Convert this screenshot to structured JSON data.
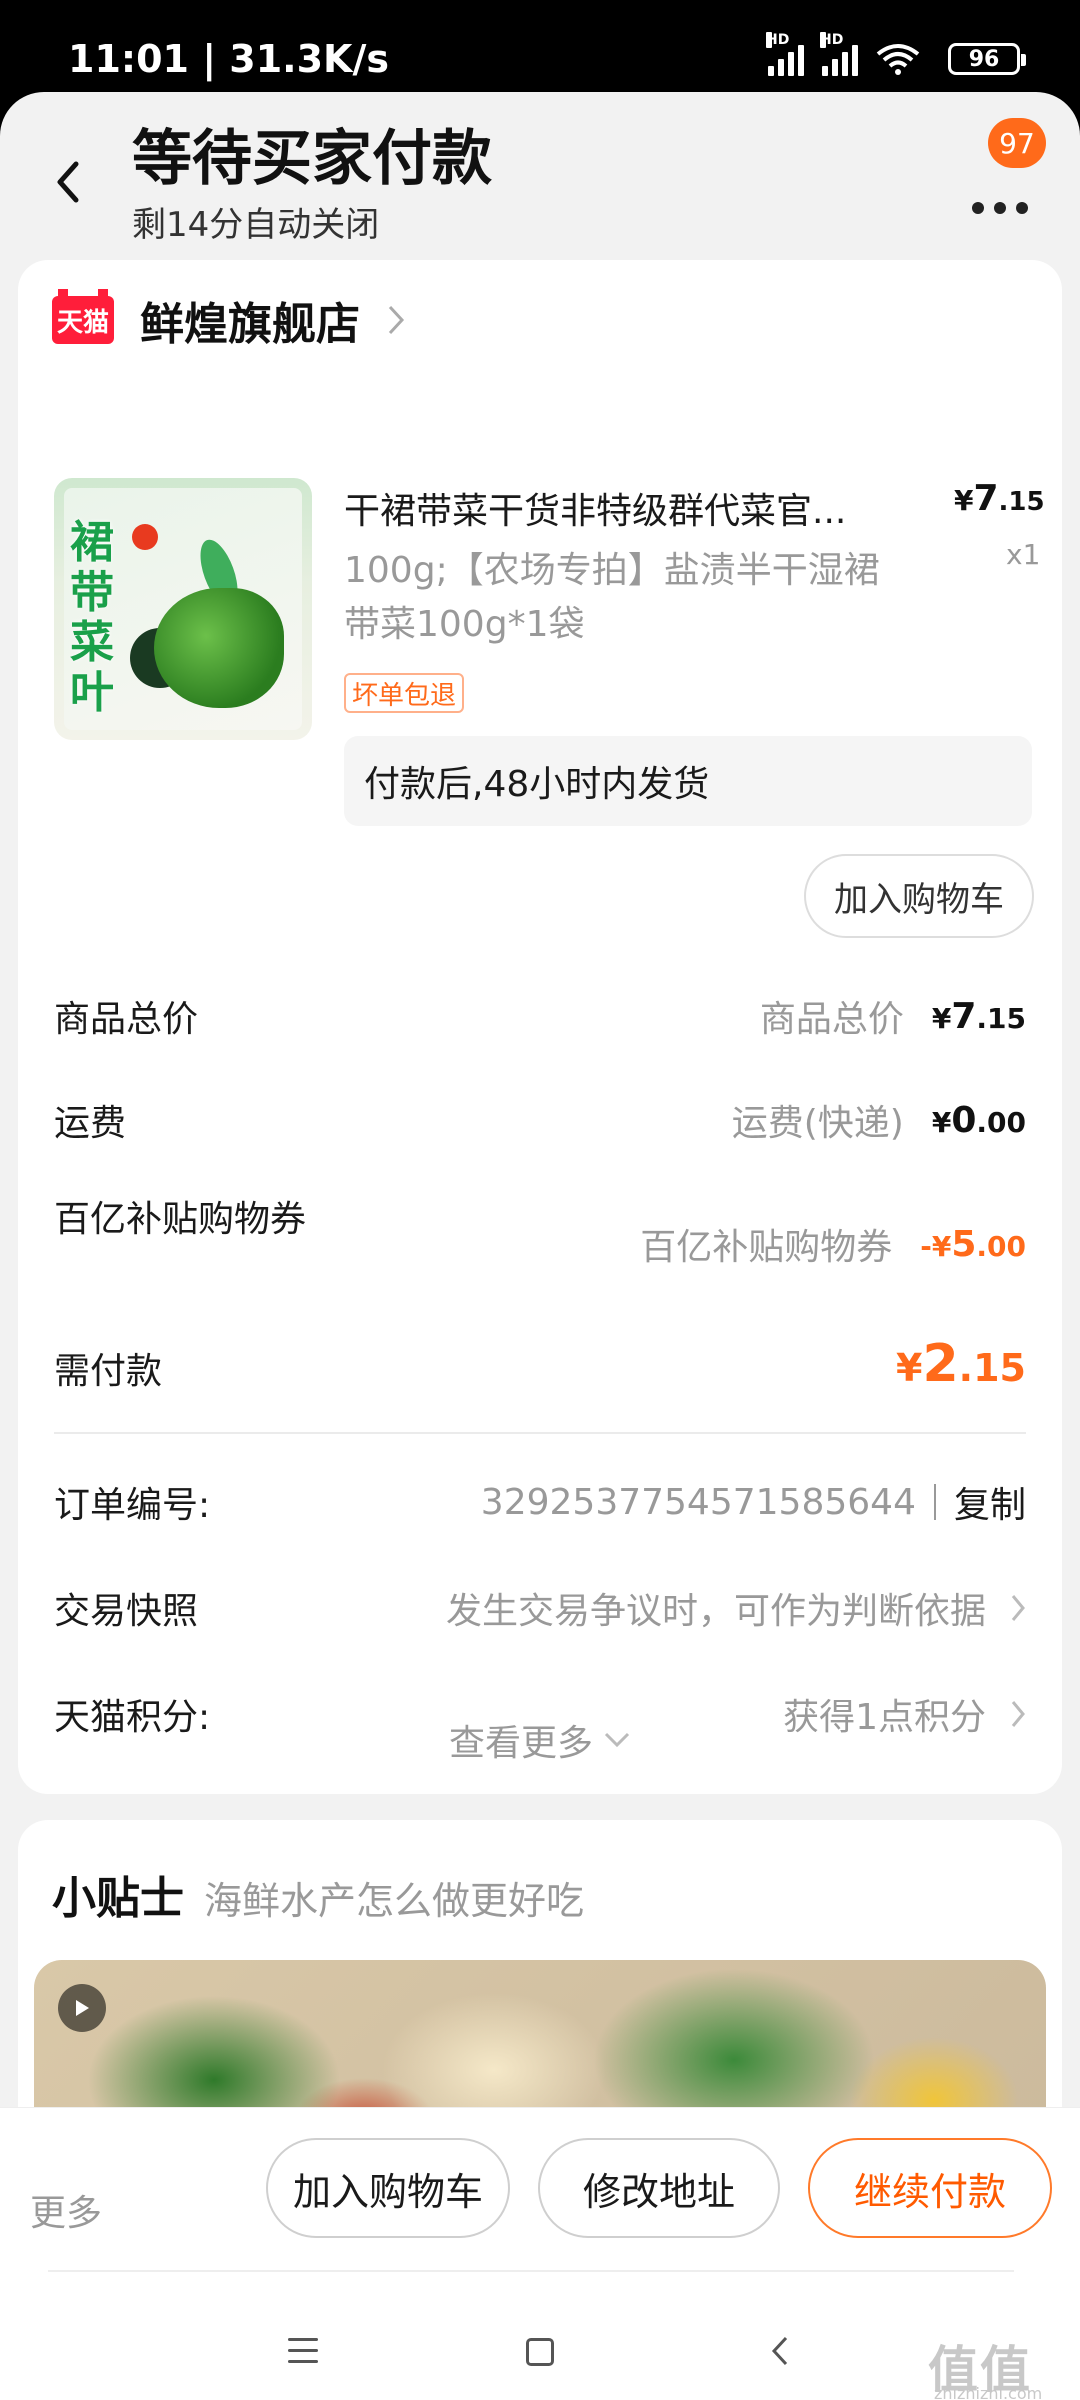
{
  "status_bar": {
    "time_speed": "11:01 | 31.3K/s",
    "hd1": "HD",
    "hd2": "HD",
    "battery": "96"
  },
  "header": {
    "title": "等待买家付款",
    "subtitle": "剩14分自动关闭",
    "message_count": "97"
  },
  "shop": {
    "logo_text": "天猫",
    "name": "鲜煌旗舰店"
  },
  "product": {
    "title": "干裙带菜干货非特级群代菜官...",
    "price_yen": "¥",
    "price_int": "7",
    "price_dec": ".15",
    "quantity": "x1",
    "spec": "100g;【农场专拍】盐渍半干湿裙带菜100g*1袋",
    "tag": "坏单包退",
    "shipping_note": "付款后,48小时内发货",
    "add_cart": "加入购物车",
    "image_text": "裙带菜叶"
  },
  "summary": {
    "goods_total": {
      "label": "商品总价",
      "sub": "商品总价",
      "yen": "¥",
      "int": "7",
      "dec": ".15"
    },
    "freight": {
      "label": "运费",
      "sub": "运费(快递)",
      "yen": "¥",
      "int": "0",
      "dec": ".00"
    },
    "coupon": {
      "label": "百亿补贴购物券",
      "sub": "百亿补贴购物券",
      "yen": "-¥",
      "int": "5",
      "dec": ".00"
    },
    "due": {
      "label": "需付款",
      "yen": "¥",
      "int": "2",
      "dec": ".15"
    }
  },
  "order_info": {
    "order_no_label": "订单编号:",
    "order_no": "3292537754571585644",
    "copy": "复制",
    "snapshot_label": "交易快照",
    "snapshot_value": "发生交易争议时，可作为判断依据",
    "points_label": "天猫积分:",
    "points_value": "获得1点积分",
    "see_more": "查看更多"
  },
  "tips": {
    "title": "小贴士",
    "subtitle": "海鲜水产怎么做更好吃"
  },
  "bottom": {
    "more": "更多",
    "add_cart": "加入购物车",
    "change_address": "修改地址",
    "continue_pay": "继续付款"
  },
  "watermark": {
    "text": "值值值",
    "url": "zhizhizhi.com"
  },
  "colors": {
    "accent": "#ff6a1a",
    "tmall_red": "#ff1e3a"
  }
}
